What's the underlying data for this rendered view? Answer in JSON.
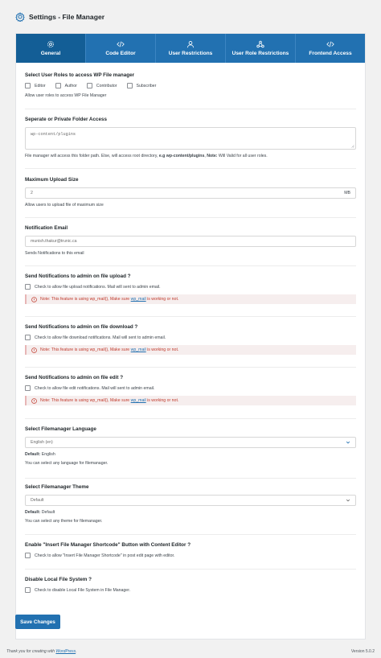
{
  "page": {
    "title": "Settings - File Manager"
  },
  "tabs": [
    {
      "label": "General",
      "icon": "gear-icon",
      "active": true
    },
    {
      "label": "Code Editor",
      "icon": "code-icon"
    },
    {
      "label": "User Restrictions",
      "icon": "user-icon"
    },
    {
      "label": "User Role Restrictions",
      "icon": "network-icon"
    },
    {
      "label": "Frontend Access",
      "icon": "code-icon"
    }
  ],
  "user_roles": {
    "title": "Select User Roles to access WP File manager",
    "roles": [
      "Editor",
      "Author",
      "Contributor",
      "Subscriber"
    ],
    "hint": "Allow user roles to access WP File Manager"
  },
  "folder": {
    "title": "Seperate or Private Folder Access",
    "value": "wp-content/plugins",
    "hint_prefix": "File manager will access this folder path. Else, will access root directory, ",
    "hint_bold": "e.g wp-content/plugins",
    "hint_note_label": "Note:",
    "hint_note": " Will Valid for all user roles."
  },
  "upload": {
    "title": "Maximum Upload Size",
    "value": "2",
    "unit": "MB",
    "hint": "Allow users to upload file of maximum size"
  },
  "email": {
    "title": "Notification Email",
    "value": "munish.thakur@trunic.ca",
    "hint": "Sends Notifications to this email"
  },
  "note": {
    "prefix": "Note: This feature is using wp_mail(), Make sure ",
    "link": "wp_mail",
    "suffix": " is working or not."
  },
  "notify_upload": {
    "title": "Send Notifications to admin on file upload ?",
    "label": "Check to allow file upload notifications. Mail will sent to admin email."
  },
  "notify_download": {
    "title": "Send Notifications to admin on file download ?",
    "label": "Check to allow file download notifications. Mail will sent to admin email."
  },
  "notify_edit": {
    "title": "Send Notifications to admin on file edit ?",
    "label": "Check to allow file edit notifications. Mail will sent to admin email."
  },
  "language": {
    "title": "Select Filemanager Language",
    "selected": "English (en)",
    "default_label": "Default:",
    "default_value": "English",
    "hint": "You can select any language for filemanager."
  },
  "theme": {
    "title": "Select Filemanager Theme",
    "selected": "Default",
    "default_label": "Default:",
    "default_value": "Default",
    "hint": "You can select any theme for filemanager."
  },
  "shortcode": {
    "title": "Enable \"Insert File Manager Shortcode\" Button with Content Editor ?",
    "label": "Check to allow \"Insert File Manager Shortcode\" in post edit page with editor."
  },
  "local_fs": {
    "title": "Disable Local File System ?",
    "label": "Check to disable Local File System in File Manager."
  },
  "save_label": "Save Changes",
  "footer": {
    "prefix": "Thank you for creating with ",
    "link": "WordPress",
    "suffix": ".",
    "version": "Version 5.0.2"
  },
  "colors": {
    "accent": "#2271b1",
    "active_tab": "#135e96",
    "error": "#c0392b"
  }
}
